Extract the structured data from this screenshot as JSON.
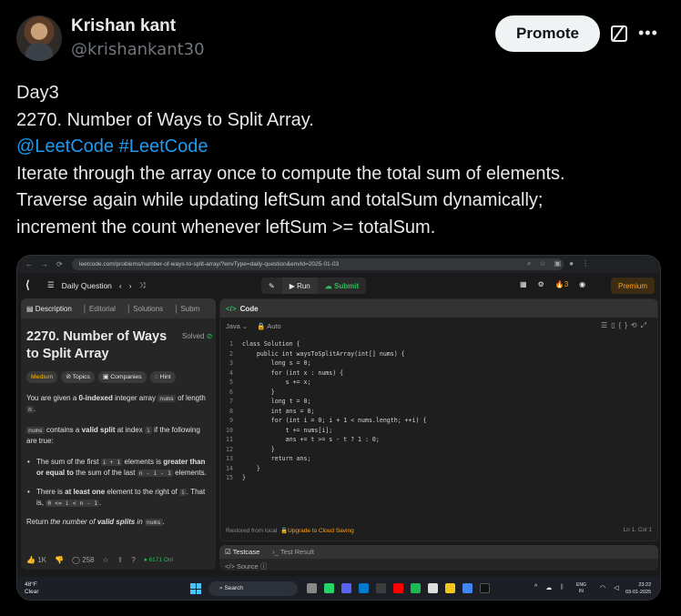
{
  "tweet": {
    "author_name": "Krishan kant",
    "author_handle": "@krishankant30",
    "promote_label": "Promote",
    "more_label": "•••",
    "line1": "Day3",
    "line2": "2270. Number of Ways to Split Array.",
    "mention1": "@LeetCode",
    "mention2": "#LeetCode",
    "line4": "Iterate through the array once to compute the total sum of elements.",
    "line5": "Traverse again while updating leftSum and totalSum dynamically;",
    "line6": "increment the count whenever leftSum >= totalSum."
  },
  "browser": {
    "url": "leetcode.com/problems/number-of-ways-to-split-array/?envType=daily-question&envId=2025-01-03"
  },
  "leetcode": {
    "daily_label": "Daily Question",
    "run_label": "Run",
    "submit_label": "Submit",
    "streak": "3",
    "premium_label": "Premium",
    "tabs": [
      "Description",
      "Editorial",
      "Solutions",
      "Subm"
    ],
    "problem_title": "2270. Number of Ways to Split Array",
    "solved_label": "Solved",
    "chips": [
      "Medium",
      "Topics",
      "Companies",
      "Hint"
    ],
    "desc": {
      "p1_a": "You are given a ",
      "p1_b": "0-indexed",
      "p1_c": " integer array ",
      "p1_code": "nums",
      "p1_d": " of length ",
      "p1_code2": "n",
      "p1_e": ".",
      "p2_code": "nums",
      "p2_a": " contains a ",
      "p2_b": "valid split",
      "p2_c": " at index ",
      "p2_code2": "i",
      "p2_d": " if the following are true:",
      "b1_a": "The sum of the first ",
      "b1_code": "i + 1",
      "b1_b": " elements is ",
      "b1_c": "greater than or equal to",
      "b1_d": " the sum of the last ",
      "b1_code2": "n - i - 1",
      "b1_e": " elements.",
      "b2_a": "There is ",
      "b2_b": "at least one",
      "b2_c": " element to the right of ",
      "b2_code": "i",
      "b2_d": ". That is, ",
      "b2_code2": "0 <= i < n - 1",
      "b2_e": ".",
      "p3_a": "Return ",
      "p3_b": "the number of ",
      "p3_c": "valid splits",
      "p3_d": " in ",
      "p3_code": "nums",
      "p3_e": "."
    },
    "likes": "1K",
    "comments": "258",
    "online": "6171 Onl",
    "code_title": "Code",
    "language": "Java",
    "auto_label": "Auto",
    "code_lines": [
      "class Solution {",
      "    public int waysToSplitArray(int[] nums) {",
      "        long s = 0;",
      "        for (int x : nums) {",
      "            s += x;",
      "        }",
      "        long t = 0;",
      "        int ans = 0;",
      "        for (int i = 0; i + 1 < nums.length; ++i) {",
      "            t += nums[i];",
      "            ans += t >= s - t ? 1 : 0;",
      "        }",
      "        return ans;",
      "    }",
      "}"
    ],
    "line_numbers": [
      "1",
      "2",
      "3",
      "4",
      "5",
      "6",
      "7",
      "8",
      "9",
      "10",
      "11",
      "12",
      "13",
      "14",
      "15"
    ],
    "restored_label": "Restored from local",
    "upgrade_label": "Upgrade to Cloud Saving",
    "cursor_pos": "Ln 1, Col 1",
    "testcase_label": "Testcase",
    "test_result_label": "Test Result",
    "source_label": "Source"
  },
  "taskbar": {
    "temp": "48°F",
    "weather": "Clear",
    "search_placeholder": "Search",
    "lang_top": "ENG",
    "lang_bottom": "IN",
    "time": "23:22",
    "date": "03-01-2025"
  }
}
